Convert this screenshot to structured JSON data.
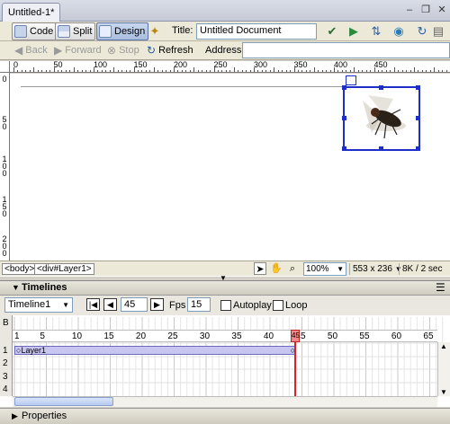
{
  "document_tab": {
    "label": "Untitled-1*"
  },
  "window_controls": {
    "minimize": "–",
    "restore": "❐",
    "close": "✕"
  },
  "doc_toolbar": {
    "code_label": "Code",
    "split_label": "Split",
    "design_label": "Design",
    "title_label": "Title:",
    "title_value": "Untitled Document"
  },
  "nav_bar": {
    "back_label": "Back",
    "forward_label": "Forward",
    "stop_label": "Stop",
    "refresh_label": "Refresh",
    "address_label": "Address:",
    "address_value": ""
  },
  "ruler": {
    "horizontal_labels": [
      "0",
      "50",
      "100",
      "150",
      "200",
      "250",
      "300",
      "350",
      "400",
      "450"
    ],
    "vertical_labels": [
      "0",
      "50",
      "100",
      "150",
      "200"
    ]
  },
  "status_bar": {
    "tag_body": "<body>",
    "tag_div": "<div#Layer1>",
    "zoom": "100%",
    "dimensions": "553 x 236",
    "download": "8K / 2 sec"
  },
  "timelines": {
    "panel_title": "Timelines",
    "timeline_name": "Timeline1",
    "current_frame": "45",
    "fps_label": "Fps",
    "fps_value": "15",
    "autoplay_label": "Autoplay",
    "autoplay_checked": false,
    "loop_label": "Loop",
    "loop_checked": false,
    "behavior_row_label": "B",
    "row_numbers": [
      "1",
      "2",
      "3",
      "4"
    ],
    "frame_labels": [
      "1",
      "5",
      "10",
      "15",
      "20",
      "25",
      "30",
      "35",
      "40",
      "45",
      "50",
      "55",
      "60",
      "65"
    ],
    "playhead_label": "45",
    "layer_bar_label": "Layer1"
  },
  "properties_panel": {
    "title": "Properties"
  },
  "colors": {
    "selection_blue": "#1d2fc8",
    "playhead_red": "#e02020",
    "layer_bar": "#c8c6f0"
  }
}
